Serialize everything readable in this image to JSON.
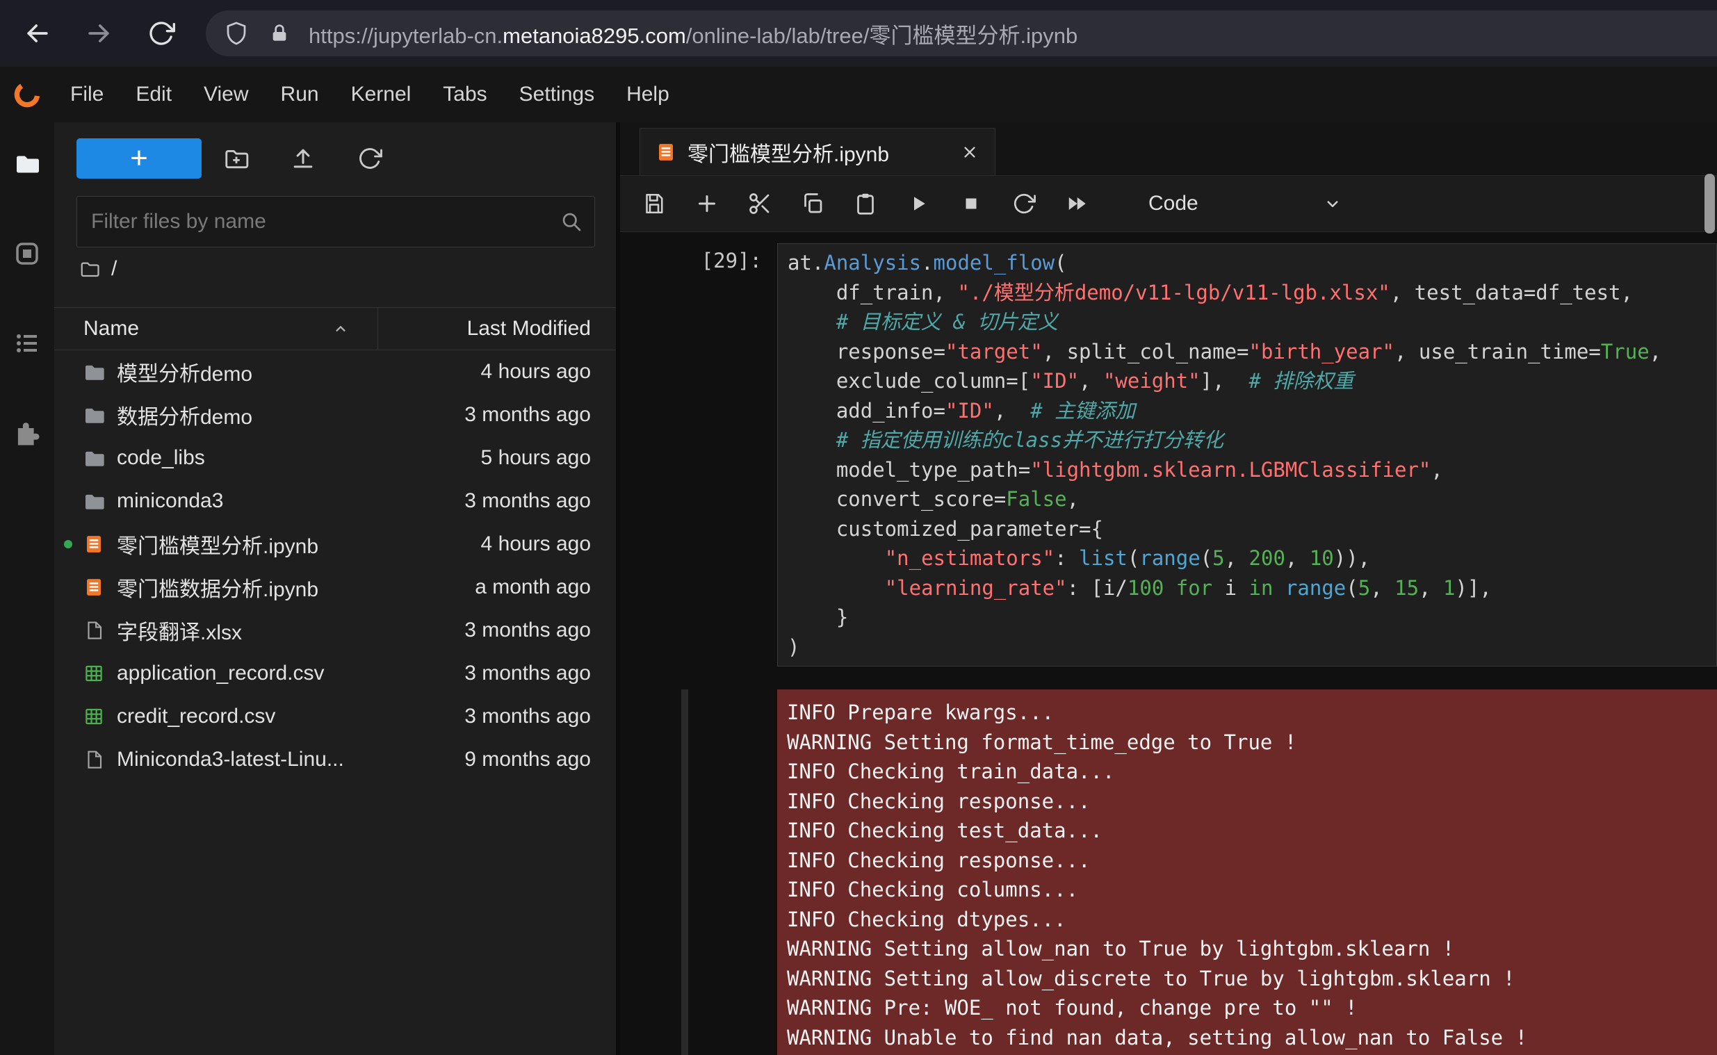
{
  "browser": {
    "url_scheme_sub": "https://jupyterlab-cn.",
    "url_domain": "metanoia8295.com",
    "url_path": "/online-lab/lab/tree/零门槛模型分析.ipynb"
  },
  "menubar": {
    "items": [
      "File",
      "Edit",
      "View",
      "Run",
      "Kernel",
      "Tabs",
      "Settings",
      "Help"
    ]
  },
  "filebrowser": {
    "new_launcher_label": "+",
    "filter_placeholder": "Filter files by name",
    "breadcrumb_root": "/",
    "header": {
      "name": "Name",
      "modified": "Last Modified"
    },
    "files": [
      {
        "name": "模型分析demo",
        "modified": "4 hours ago",
        "type": "folder",
        "running": false
      },
      {
        "name": "数据分析demo",
        "modified": "3 months ago",
        "type": "folder",
        "running": false
      },
      {
        "name": "code_libs",
        "modified": "5 hours ago",
        "type": "folder",
        "running": false
      },
      {
        "name": "miniconda3",
        "modified": "3 months ago",
        "type": "folder",
        "running": false
      },
      {
        "name": "零门槛模型分析.ipynb",
        "modified": "4 hours ago",
        "type": "notebook",
        "running": true
      },
      {
        "name": "零门槛数据分析.ipynb",
        "modified": "a month ago",
        "type": "notebook",
        "running": false
      },
      {
        "name": "字段翻译.xlsx",
        "modified": "3 months ago",
        "type": "file",
        "running": false
      },
      {
        "name": "application_record.csv",
        "modified": "3 months ago",
        "type": "csv",
        "running": false
      },
      {
        "name": "credit_record.csv",
        "modified": "3 months ago",
        "type": "csv",
        "running": false
      },
      {
        "name": "Miniconda3-latest-Linu...",
        "modified": "9 months ago",
        "type": "file",
        "running": false
      }
    ]
  },
  "main": {
    "tab_title": "零门槛模型分析.ipynb",
    "toolbar_mode": "Code",
    "cell": {
      "prompt": "[29]:",
      "code_lines": [
        [
          [
            "d",
            "at."
          ],
          [
            "p",
            "Analysis"
          ],
          [
            "d",
            "."
          ],
          [
            "p",
            "model_flow"
          ],
          [
            "d",
            "("
          ]
        ],
        [
          [
            "d",
            "    df_train, "
          ],
          [
            "s",
            "\"./模型分析demo/v11-lgb/v11-lgb.xlsx\""
          ],
          [
            "d",
            ", test_data=df_test,"
          ]
        ],
        [
          [
            "d",
            "    "
          ],
          [
            "c",
            "# 目标定义 & 切片定义"
          ]
        ],
        [
          [
            "d",
            "    response="
          ],
          [
            "s",
            "\"target\""
          ],
          [
            "d",
            ", split_col_name="
          ],
          [
            "s",
            "\"birth_year\""
          ],
          [
            "d",
            ", use_train_time="
          ],
          [
            "k",
            "True"
          ],
          [
            "d",
            ","
          ]
        ],
        [
          [
            "d",
            "    exclude_column=["
          ],
          [
            "s",
            "\"ID\""
          ],
          [
            "d",
            ", "
          ],
          [
            "s",
            "\"weight\""
          ],
          [
            "d",
            "],  "
          ],
          [
            "c",
            "# 排除权重"
          ]
        ],
        [
          [
            "d",
            "    add_info="
          ],
          [
            "s",
            "\"ID\""
          ],
          [
            "d",
            ",  "
          ],
          [
            "c",
            "# 主键添加"
          ]
        ],
        [
          [
            "d",
            "    "
          ],
          [
            "c",
            "# 指定使用训练的class并不进行打分转化"
          ]
        ],
        [
          [
            "d",
            "    model_type_path="
          ],
          [
            "s",
            "\"lightgbm.sklearn.LGBMClassifier\""
          ],
          [
            "d",
            ","
          ]
        ],
        [
          [
            "d",
            "    convert_score="
          ],
          [
            "k",
            "False"
          ],
          [
            "d",
            ","
          ]
        ],
        [
          [
            "d",
            "    customized_parameter={"
          ]
        ],
        [
          [
            "d",
            "        "
          ],
          [
            "s",
            "\"n_estimators\""
          ],
          [
            "d",
            ": "
          ],
          [
            "b",
            "list"
          ],
          [
            "d",
            "("
          ],
          [
            "b",
            "range"
          ],
          [
            "d",
            "("
          ],
          [
            "n",
            "5"
          ],
          [
            "d",
            ", "
          ],
          [
            "n",
            "200"
          ],
          [
            "d",
            ", "
          ],
          [
            "n",
            "10"
          ],
          [
            "d",
            ")),"
          ]
        ],
        [
          [
            "d",
            "        "
          ],
          [
            "s",
            "\"learning_rate\""
          ],
          [
            "d",
            ": [i/"
          ],
          [
            "n",
            "100"
          ],
          [
            "d",
            " "
          ],
          [
            "k",
            "for"
          ],
          [
            "d",
            " i "
          ],
          [
            "k",
            "in"
          ],
          [
            "d",
            " "
          ],
          [
            "b",
            "range"
          ],
          [
            "d",
            "("
          ],
          [
            "n",
            "5"
          ],
          [
            "d",
            ", "
          ],
          [
            "n",
            "15"
          ],
          [
            "d",
            ", "
          ],
          [
            "n",
            "1"
          ],
          [
            "d",
            ")],"
          ]
        ],
        [
          [
            "d",
            "    }"
          ]
        ],
        [
          [
            "d",
            ")"
          ]
        ]
      ]
    },
    "output_lines": [
      "INFO Prepare kwargs...",
      "WARNING Setting format_time_edge to True !",
      "INFO Checking train_data...",
      "INFO Checking response...",
      "INFO Checking test_data...",
      "INFO Checking response...",
      "INFO Checking columns...",
      "INFO Checking dtypes...",
      "WARNING Setting allow_nan to True by lightgbm.sklearn !",
      "WARNING Setting allow_discrete to True by lightgbm.sklearn !",
      "WARNING Pre: WOE_ not found, change pre to \"\" !",
      "WARNING Unable to find nan data, setting allow_nan to False !"
    ]
  },
  "colors": {
    "accent-blue": "#1e88e5",
    "notebook-orange": "#f37726",
    "running-green": "#34a853",
    "stderr-bg": "#6d2828",
    "code-string": "#ff7070",
    "code-keyword": "#55b155",
    "code-number": "#55b155",
    "code-builtin": "#4fa6d5",
    "code-comment": "#4fa8a8",
    "code-property": "#5b9bd5"
  }
}
